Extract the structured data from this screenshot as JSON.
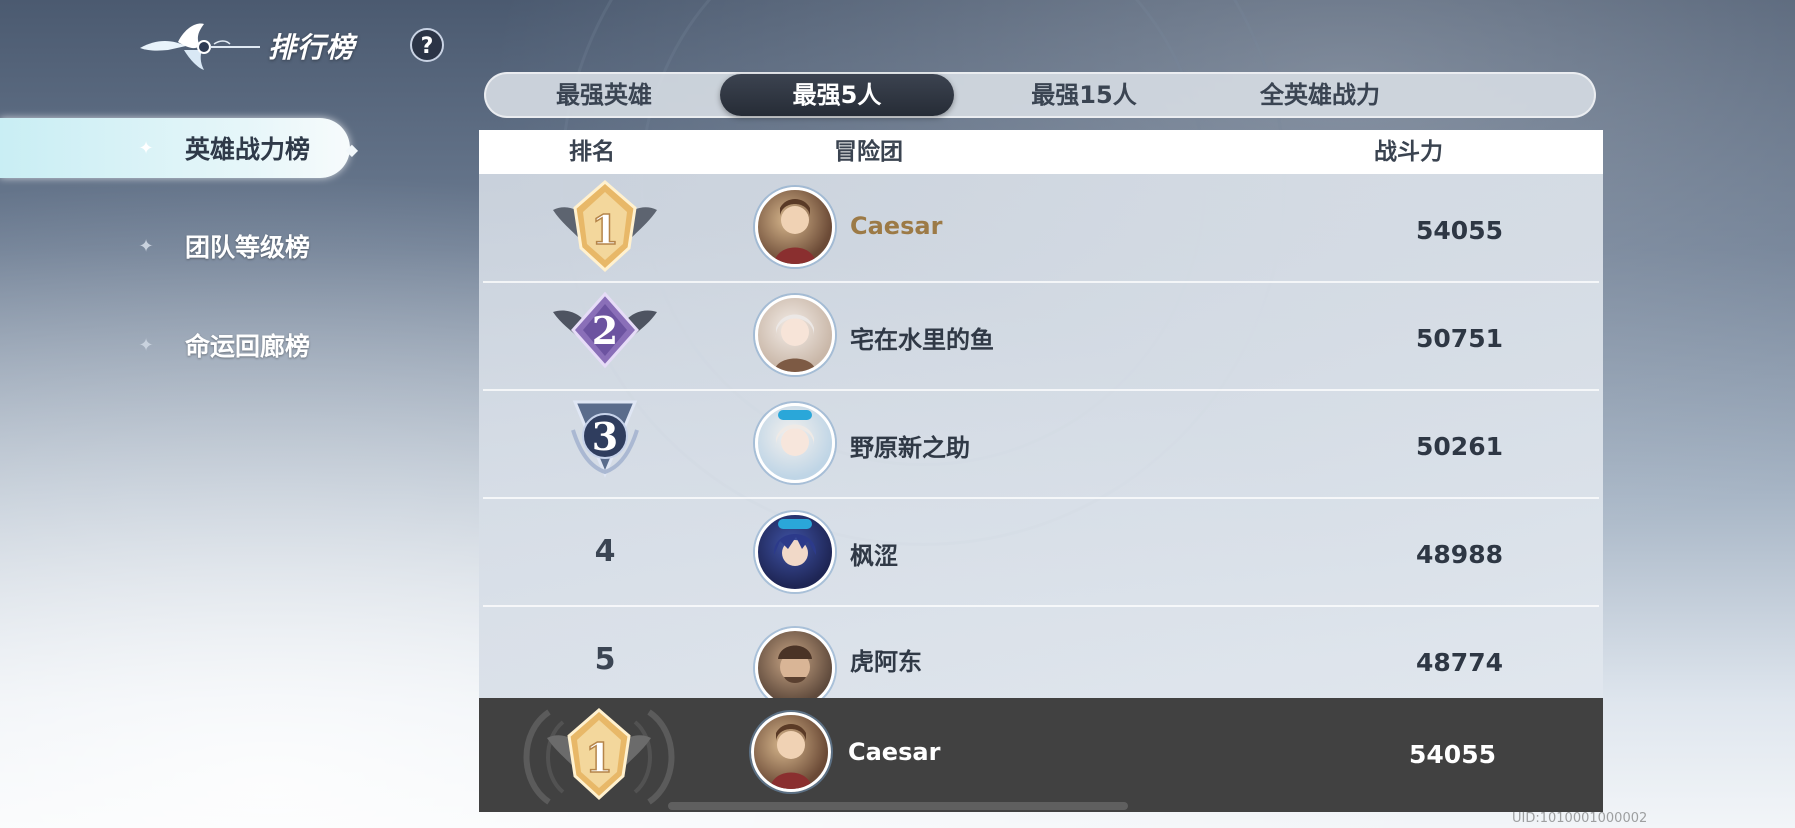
{
  "header": {
    "title": "排行榜",
    "help_label": "?"
  },
  "sidebar": {
    "items": [
      {
        "label": "英雄战力榜",
        "active": true
      },
      {
        "label": "团队等级榜",
        "active": false
      },
      {
        "label": "命运回廊榜",
        "active": false
      }
    ]
  },
  "tabs": [
    {
      "label": "最强英雄",
      "active": false
    },
    {
      "label": "最强5人",
      "active": true
    },
    {
      "label": "最强15人",
      "active": false
    },
    {
      "label": "全英雄战力",
      "active": false
    }
  ],
  "table": {
    "columns": {
      "rank": "排名",
      "team": "冒险团",
      "power": "战斗力"
    },
    "rows": [
      {
        "rank": "1",
        "name": "Caesar",
        "power": "54055",
        "badge": "gold-rank-1-badge",
        "highlight": true
      },
      {
        "rank": "2",
        "name": "宅在水里的鱼",
        "power": "50751",
        "badge": "purple-rank-2-badge"
      },
      {
        "rank": "3",
        "name": "野原新之助",
        "power": "50261",
        "badge": "blue-rank-3-badge"
      },
      {
        "rank": "4",
        "name": "枫涩",
        "power": "48988"
      },
      {
        "rank": "5",
        "name": "虎阿东",
        "power": "48774"
      }
    ],
    "self": {
      "rank": "1",
      "name": "Caesar",
      "power": "54055"
    }
  },
  "footer": {
    "uid": "UID:1010001000002"
  },
  "colors": {
    "accent_gold": "#9c7a46",
    "active_tab": "#2b313b",
    "self_row": "#414141"
  }
}
